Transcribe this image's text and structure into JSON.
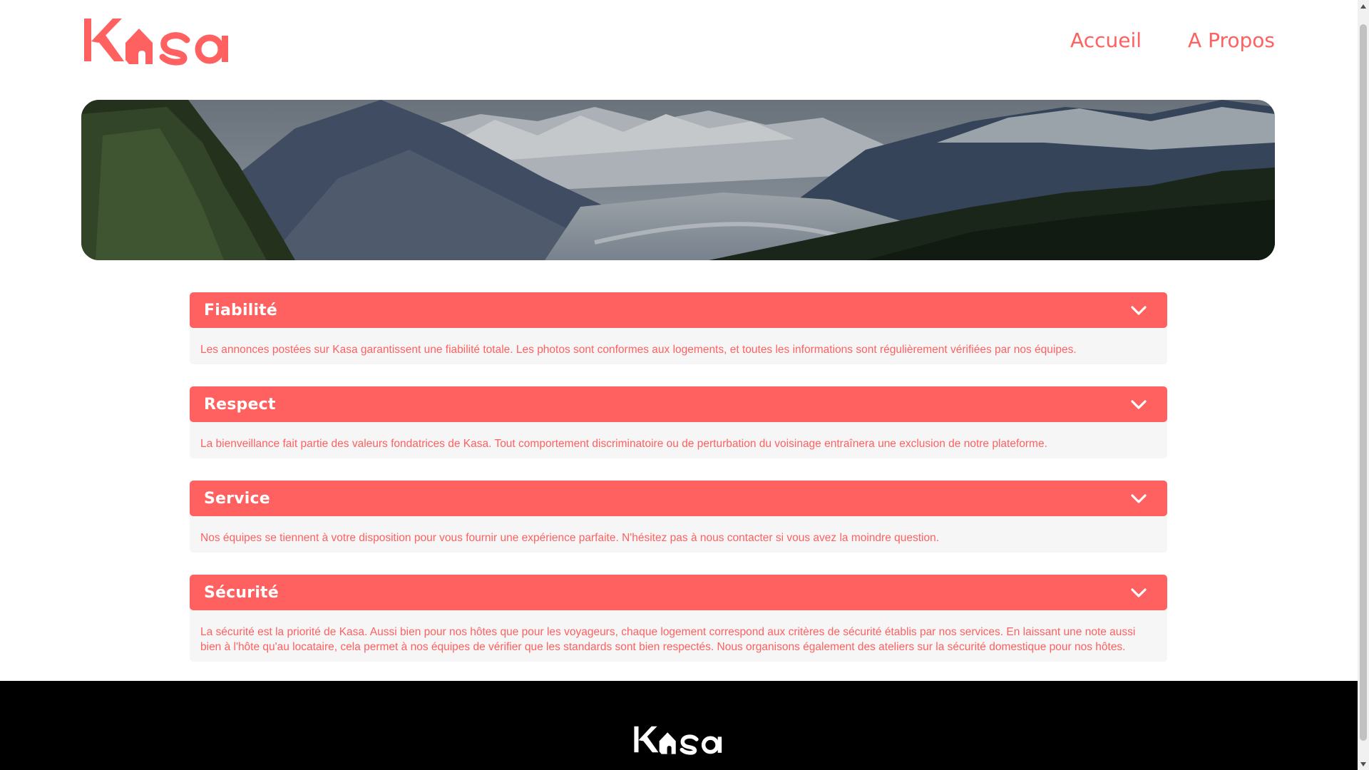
{
  "brand": {
    "name": "Kasa",
    "color": "#FF6060"
  },
  "nav": {
    "home_label": "Accueil",
    "about_label": "A Propos"
  },
  "collapses": [
    {
      "title": "Fiabilité",
      "text": "Les annonces postées sur Kasa garantissent une fiabilité totale. Les photos sont conformes aux logements, et toutes les informations sont régulièrement vérifiées par nos équipes."
    },
    {
      "title": "Respect",
      "text": "La bienveillance fait partie des valeurs fondatrices de Kasa. Tout comportement discriminatoire ou de perturbation du voisinage entraînera une exclusion de notre plateforme."
    },
    {
      "title": "Service",
      "text": "Nos équipes se tiennent à votre disposition pour vous fournir une expérience parfaite. N'hésitez pas à nous contacter si vous avez la moindre question."
    },
    {
      "title": "Sécurité",
      "text": "La sécurité est la priorité de Kasa. Aussi bien pour nos hôtes que pour les voyageurs, chaque logement correspond aux critères de sécurité établis par nos services. En laissant une note aussi bien à l'hôte qu'au locataire, cela permet à nos équipes de vérifier que les standards sont bien respectés. Nous organisons également des ateliers sur la sécurité domestique pour nos hôtes."
    }
  ],
  "icons": {
    "collapse_toggle": "chevron-down-icon",
    "banner": "mountain-landscape-image"
  }
}
